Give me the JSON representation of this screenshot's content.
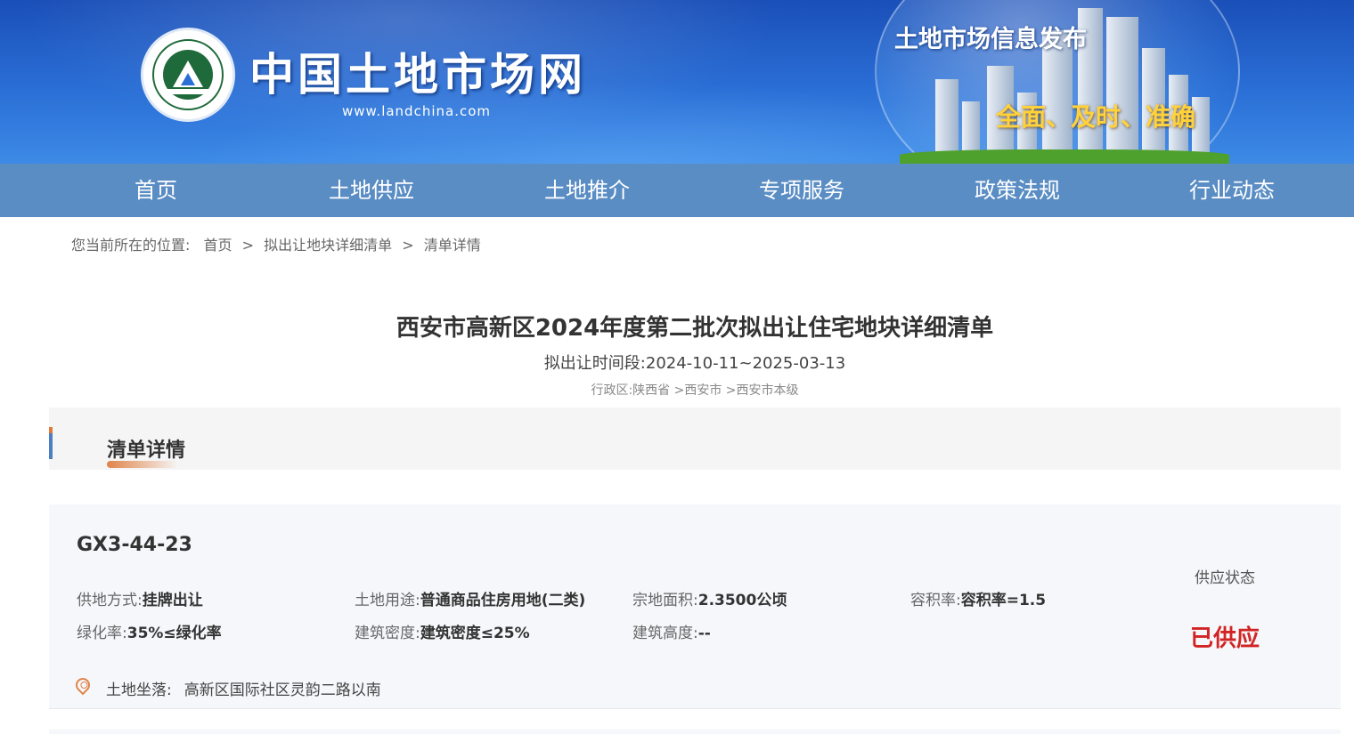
{
  "banner": {
    "site_title": "中国土地市场网",
    "site_url": "www.landchina.com",
    "logo_ring_text": "中国土地市场网 WWW.LANDCHINA.COM",
    "slogan_title": "土地市场信息发布",
    "slogan_tagline": "全面、及时、准确"
  },
  "nav": {
    "items": [
      "首页",
      "土地供应",
      "土地推介",
      "专项服务",
      "政策法规",
      "行业动态"
    ]
  },
  "breadcrumb": {
    "prefix": "您当前所在的位置:",
    "items": [
      "首页",
      "拟出让地块详细清单",
      "清单详情"
    ],
    "separator": ">"
  },
  "document": {
    "title": "西安市高新区2024年度第二批次拟出让住宅地块详细清单",
    "period": "拟出让时间段:2024-10-11~2025-03-13",
    "region": "行政区:陕西省 >西安市 >西安市本级"
  },
  "section": {
    "title": "清单详情"
  },
  "parcel": {
    "code": "GX3-44-23",
    "fields": {
      "supply_method": {
        "label": "供地方式:",
        "value": "挂牌出让"
      },
      "land_use": {
        "label": "土地用途:",
        "value": "普通商品住房用地(二类)"
      },
      "area": {
        "label": "宗地面积:",
        "value": "2.3500公顷"
      },
      "plot_ratio": {
        "label": "容积率:",
        "value": "容积率=1.5"
      },
      "green_ratio": {
        "label": "绿化率:",
        "value": "35%≤绿化率"
      },
      "building_density": {
        "label": "建筑密度:",
        "value": "建筑密度≤25%"
      },
      "building_height": {
        "label": "建筑高度:",
        "value": "--"
      }
    },
    "status_label": "供应状态",
    "status_value": "已供应",
    "location": {
      "label": "土地坐落:",
      "value": "高新区国际社区灵韵二路以南"
    },
    "colors": {
      "status": "#d22424",
      "accent": "#e0844a",
      "nav": "#5a8dc4"
    }
  }
}
